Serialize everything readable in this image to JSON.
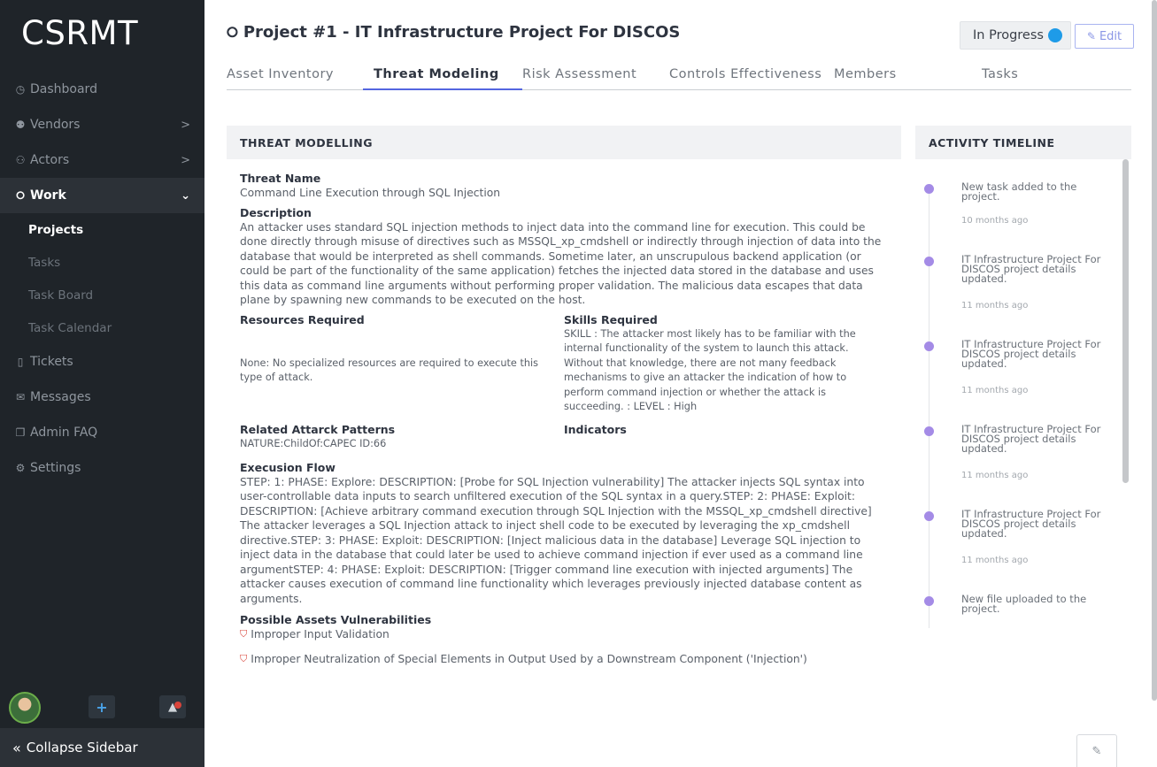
{
  "app": {
    "logo": "CSRMT"
  },
  "sidebar": {
    "items": [
      {
        "label": "Dashboard",
        "icon": "gauge-icon",
        "glyph": "◷"
      },
      {
        "label": "Vendors",
        "icon": "vendors-icon",
        "glyph": "⚉",
        "chevron": ">"
      },
      {
        "label": "Actors",
        "icon": "actors-icon",
        "glyph": "⚇",
        "chevron": ">"
      },
      {
        "label": "Work",
        "icon": "layers-icon",
        "glyph": "⭘",
        "chevron": "⌄"
      }
    ],
    "sub_items": [
      {
        "label": "Projects"
      },
      {
        "label": "Tasks"
      },
      {
        "label": "Task Board"
      },
      {
        "label": "Task Calendar"
      }
    ],
    "items_after": [
      {
        "label": "Tickets",
        "icon": "ticket-icon",
        "glyph": "▯"
      },
      {
        "label": "Messages",
        "icon": "mail-icon",
        "glyph": "✉"
      },
      {
        "label": "Admin FAQ",
        "icon": "faq-icon",
        "glyph": "❐"
      },
      {
        "label": "Settings",
        "icon": "gear-icon",
        "glyph": "⚙"
      }
    ],
    "add_label": "+",
    "bell_glyph": "▲",
    "collapse_icon": "«",
    "collapse_label": "Collapse Sidebar"
  },
  "header": {
    "title_icon": "⭘",
    "title": "Project #1 - IT Infrastructure Project For DISCOS",
    "status": "In Progress",
    "status_color": "#1e9be8",
    "edit_icon": "✎",
    "edit_label": "Edit"
  },
  "tabs": [
    {
      "label": "Asset Inventory"
    },
    {
      "label": "Threat Modeling"
    },
    {
      "label": "Risk Assessment"
    },
    {
      "label": "Controls Effectiveness"
    },
    {
      "label": "Members"
    },
    {
      "label": "Tasks"
    }
  ],
  "threat": {
    "panel_title": "THREAT MODELLING",
    "name_label": "Threat Name",
    "name": "Command Line Execution through SQL Injection",
    "description_label": "Description",
    "description": "An attacker uses standard SQL injection methods to inject data into the command line for execution. This could be done directly through misuse of directives such as MSSQL_xp_cmdshell or indirectly through injection of data into the database that would be interpreted as shell commands. Sometime later, an unscrupulous backend application (or could be part of the functionality of the same application) fetches the injected data stored in the database and uses this data as command line arguments without performing proper validation. The malicious data escapes that data plane by spawning new commands to be executed on the host.",
    "resources_label": "Resources Required",
    "resources": "None: No specialized resources are required to execute this type of attack.",
    "skills_label": "Skills Required",
    "skills": "SKILL : The attacker most likely has to be familiar with the internal functionality of the system to launch this attack. Without that knowledge, there are not many feedback mechanisms to give an attacker the indication of how to perform command injection or whether the attack is succeeding. : LEVEL : High",
    "patterns_label": "Related Attarck Patterns",
    "patterns": "NATURE:ChildOf:CAPEC ID:66",
    "indicators_label": "Indicators",
    "flow_label": "Execusion Flow",
    "flow": "STEP: 1: PHASE: Explore: DESCRIPTION: [Probe for SQL Injection vulnerability] The attacker injects SQL syntax into user-controllable data inputs to search unfiltered execution of the SQL syntax in a query.STEP: 2: PHASE: Exploit: DESCRIPTION: [Achieve arbitrary command execution through SQL Injection with the MSSQL_xp_cmdshell directive] The attacker leverages a SQL Injection attack to inject shell code to be executed by leveraging the xp_cmdshell directive.STEP: 3: PHASE: Exploit: DESCRIPTION: [Inject malicious data in the database] Leverage SQL injection to inject data in the database that could later be used to achieve command injection if ever used as a command line argumentSTEP: 4: PHASE: Exploit: DESCRIPTION: [Trigger command line execution with injected arguments] The attacker causes execution of command line functionality which leverages previously injected database content as arguments.",
    "vuln_label": "Possible Assets Vulnerabilities",
    "vuln_icon": "⛉",
    "vulnerabilities": [
      "Improper Input Validation",
      "Improper Neutralization of Special Elements in Output Used by a Downstream Component ('Injection')"
    ]
  },
  "activity": {
    "title": "ACTIVITY TIMELINE",
    "items": [
      {
        "text": "New task added to the project.",
        "time": "10 months ago"
      },
      {
        "text": "IT Infrastructure Project For DISCOS project details updated.",
        "time": "11 months ago"
      },
      {
        "text": "IT Infrastructure Project For DISCOS project details updated.",
        "time": "11 months ago"
      },
      {
        "text": "IT Infrastructure Project For DISCOS project details updated.",
        "time": "11 months ago"
      },
      {
        "text": "IT Infrastructure Project For DISCOS project details updated.",
        "time": "11 months ago"
      },
      {
        "text": "New file uploaded to the project.",
        "time": ""
      }
    ]
  },
  "fab_icon": "✎"
}
